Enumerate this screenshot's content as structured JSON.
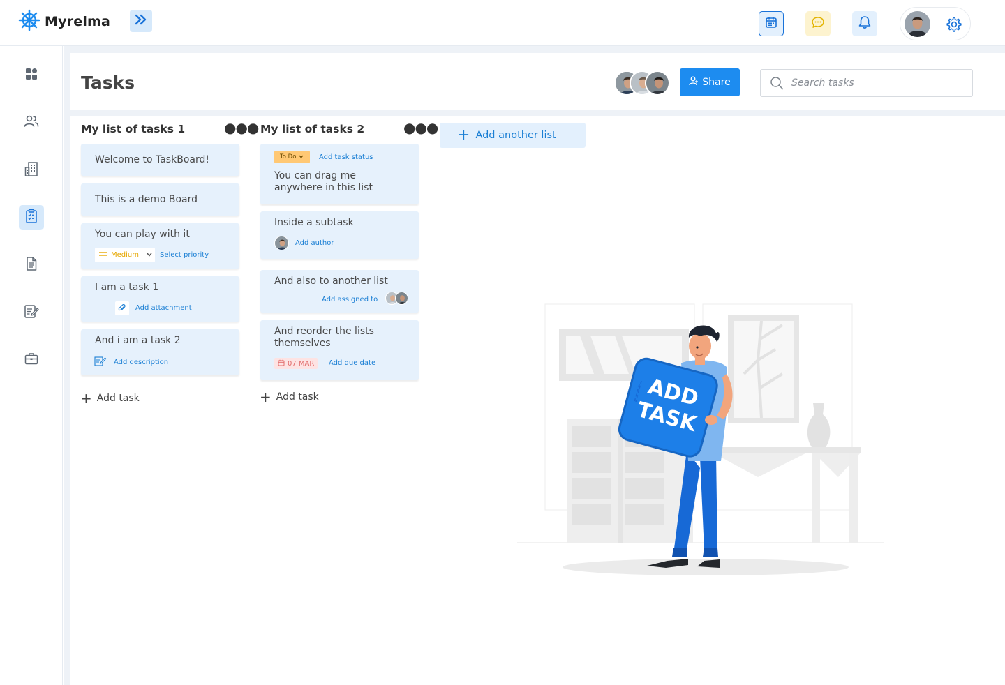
{
  "app": {
    "name": "Myrelma"
  },
  "header": {
    "expand_label": "Expand sidebar"
  },
  "page": {
    "title": "Tasks",
    "share_label": "Share",
    "search_placeholder": "Search tasks"
  },
  "sidebar": {
    "items": [
      {
        "name": "dashboard",
        "icon": "grid-icon"
      },
      {
        "name": "users",
        "icon": "users-icon"
      },
      {
        "name": "buildings",
        "icon": "building-icon"
      },
      {
        "name": "tasks",
        "icon": "clipboard-icon",
        "active": true
      },
      {
        "name": "documents",
        "icon": "document-icon"
      },
      {
        "name": "notes",
        "icon": "edit-document-icon"
      },
      {
        "name": "projects",
        "icon": "briefcase-icon"
      }
    ]
  },
  "lists": [
    {
      "title": "My list of tasks 1",
      "add_task_label": "Add task",
      "cards": [
        {
          "text": "Welcome to TaskBoard!"
        },
        {
          "text": "This is a demo Board"
        },
        {
          "text": "You can play with it",
          "priority": "Medium",
          "priority_link": "Select priority"
        },
        {
          "text": "I am a task 1",
          "link": "Add attachment"
        },
        {
          "text": "And i am a task 2",
          "link": "Add description"
        }
      ]
    },
    {
      "title": "My list of tasks 2",
      "add_task_label": "Add task",
      "cards": [
        {
          "text": "You can drag me anywhere in this list",
          "status": "To Do",
          "status_link": "Add task status"
        },
        {
          "text": "Inside a subtask",
          "link": "Add author"
        },
        {
          "text": "And also to another list",
          "link": "Add assigned to"
        },
        {
          "text": "And reorder the lists themselves",
          "due_date": "07 MAR",
          "link": "Add due date"
        }
      ]
    }
  ],
  "add_list_label": "Add another list",
  "illustration": {
    "sign_line1": "ADD",
    "sign_line2": "TASK"
  },
  "colors": {
    "accent": "#1d8cf0",
    "card": "#e6f1fc",
    "background": "#eef2f7",
    "priority": "#e6a700",
    "status": "#ffc874",
    "due": "#e26b6b"
  }
}
